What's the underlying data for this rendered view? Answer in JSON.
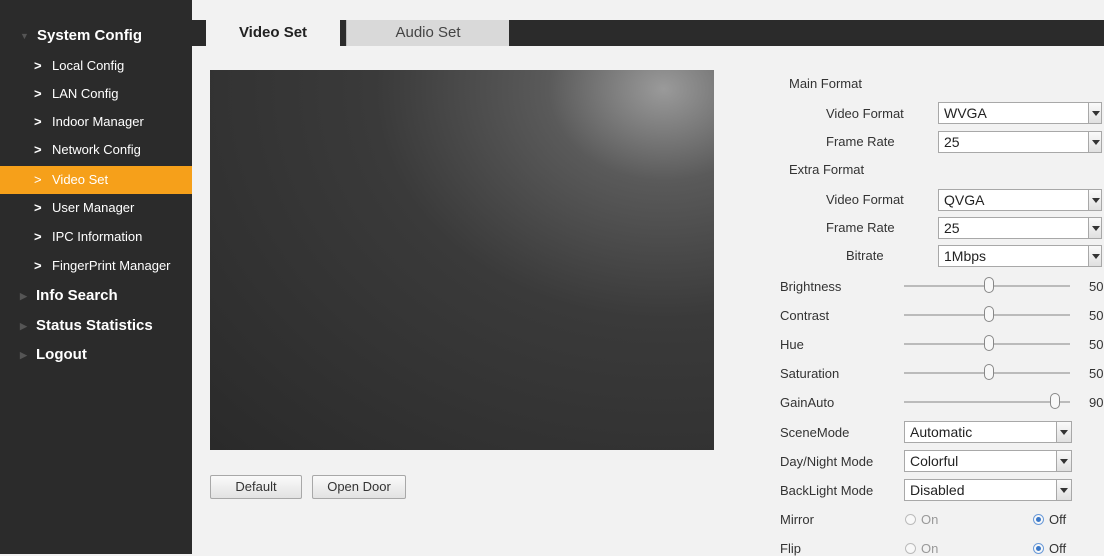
{
  "sidebar": {
    "system_config": "System Config",
    "items": [
      "Local Config",
      "LAN Config",
      "Indoor Manager",
      "Network Config",
      "Video Set",
      "User Manager",
      "IPC Information",
      "FingerPrint Manager"
    ],
    "info_search": "Info Search",
    "status_statistics": "Status Statistics",
    "logout": "Logout"
  },
  "tabs": {
    "video": "Video Set",
    "audio": "Audio Set"
  },
  "buttons": {
    "default": "Default",
    "open_door": "Open Door"
  },
  "main_format": {
    "title": "Main Format",
    "video_format_label": "Video Format",
    "video_format": "WVGA",
    "frame_rate_label": "Frame Rate",
    "frame_rate": "25"
  },
  "extra_format": {
    "title": "Extra Format",
    "video_format_label": "Video Format",
    "video_format": "QVGA",
    "frame_rate_label": "Frame Rate",
    "frame_rate": "25",
    "bitrate_label": "Bitrate",
    "bitrate": "1Mbps"
  },
  "sliders": {
    "brightness": {
      "label": "Brightness",
      "value": "50"
    },
    "contrast": {
      "label": "Contrast",
      "value": "50"
    },
    "hue": {
      "label": "Hue",
      "value": "50"
    },
    "saturation": {
      "label": "Saturation",
      "value": "50"
    },
    "gain": {
      "label": "GainAuto",
      "value": "90"
    }
  },
  "scene_mode": {
    "label": "SceneMode",
    "value": "Automatic"
  },
  "day_night": {
    "label": "Day/Night Mode",
    "value": "Colorful"
  },
  "backlight": {
    "label": "BackLight Mode",
    "value": "Disabled"
  },
  "mirror": {
    "label": "Mirror",
    "on": "On",
    "off": "Off",
    "selected": "Off"
  },
  "flip": {
    "label": "Flip",
    "on": "On",
    "off": "Off",
    "selected": "Off"
  },
  "colors": {
    "sidebar_bg": "#2b2b2b",
    "active_item": "#f6a01a",
    "radio_selected": "#3a78c8"
  },
  "icons": {
    "nav_item": "chevron-right-icon",
    "section": "triangle-icon"
  }
}
